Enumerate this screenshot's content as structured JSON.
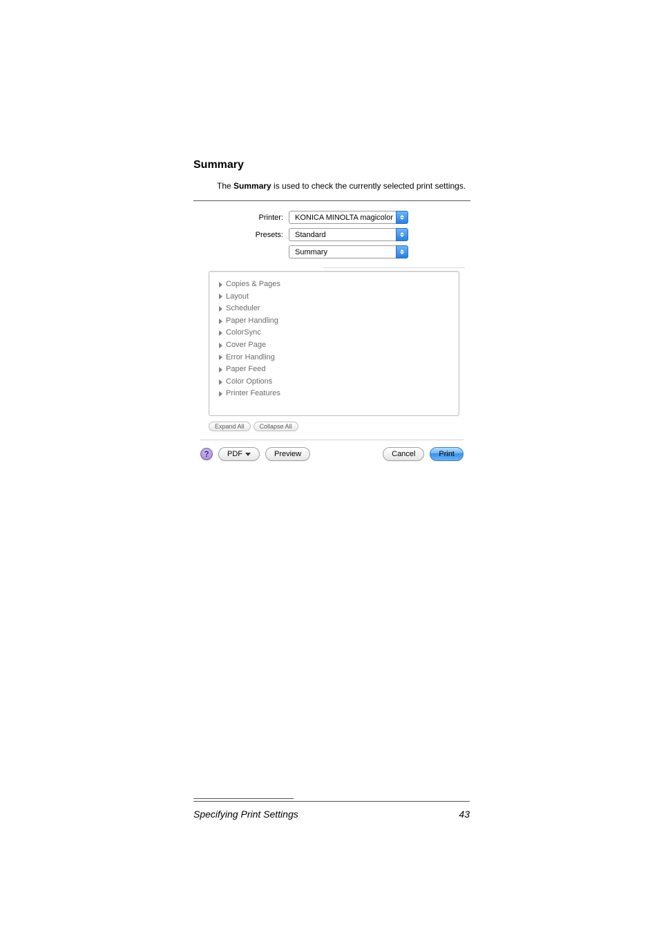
{
  "heading": "Summary",
  "body": {
    "pre": "The ",
    "bold": "Summary",
    "post": " is used to check the currently selected print settings."
  },
  "dialog": {
    "printer_label": "Printer:",
    "printer_value": "KONICA MINOLTA magicolor ...",
    "presets_label": "Presets:",
    "presets_value": "Standard",
    "panel_value": "Summary",
    "tree": {
      "copies_pages": "Copies & Pages",
      "layout": "Layout",
      "scheduler": "Scheduler",
      "paper_handling": "Paper Handling",
      "colorsync": "ColorSync",
      "cover_page": "Cover Page",
      "error_handling": "Error Handling",
      "paper_feed": "Paper Feed",
      "color_options": "Color Options",
      "printer_features": "Printer Features"
    },
    "expand_all": "Expand All",
    "collapse_all": "Collapse All",
    "help": "?",
    "pdf": "PDF",
    "preview": "Preview",
    "cancel": "Cancel",
    "print": "Print"
  },
  "footer": {
    "left": "Specifying Print Settings",
    "right": "43"
  }
}
